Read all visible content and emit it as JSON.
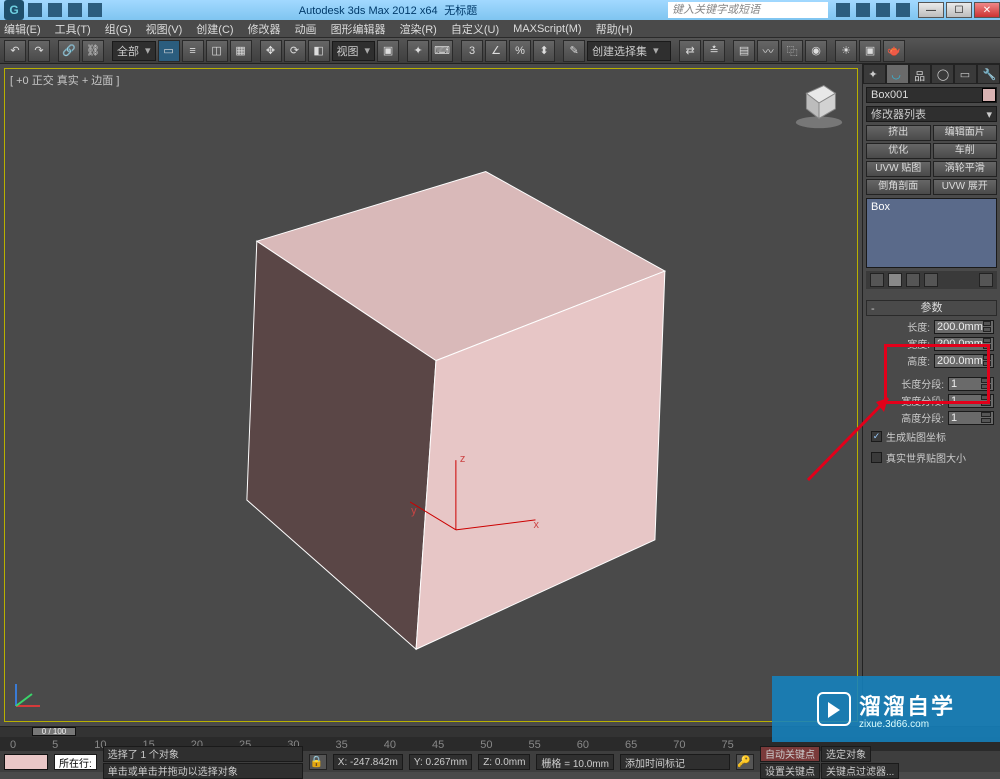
{
  "title": {
    "app": "Autodesk 3ds Max  2012 x64",
    "doc": "无标题",
    "search_placeholder": "键入关键字或短语"
  },
  "menu": [
    "编辑(E)",
    "工具(T)",
    "组(G)",
    "视图(V)",
    "创建(C)",
    "修改器",
    "动画",
    "图形编辑器",
    "渲染(R)",
    "自定义(U)",
    "MAXScript(M)",
    "帮助(H)"
  ],
  "toolbar": {
    "all": "全部",
    "view": "视图",
    "selset": "创建选择集"
  },
  "viewport": {
    "label": "[ +0 正交 真实 + 边面 ]"
  },
  "cmd": {
    "object_name": "Box001",
    "modlist": "修改器列表",
    "buttons": [
      "挤出",
      "编辑面片",
      "优化",
      "车削",
      "UVW 贴图",
      "涡轮平滑",
      "倒角剖面",
      "UVW 展开"
    ],
    "stack_item": "Box",
    "rollout": "参数",
    "params": {
      "length_l": "长度:",
      "length_v": "200.0mm",
      "width_l": "宽度:",
      "width_v": "200.0mm",
      "height_l": "高度:",
      "height_v": "200.0mm",
      "lseg_l": "长度分段:",
      "lseg_v": "1",
      "wseg_l": "宽度分段:",
      "wseg_v": "1",
      "hseg_l": "高度分段:",
      "hseg_v": "1"
    },
    "chk1": "生成贴图坐标",
    "chk2": "真实世界贴图大小"
  },
  "time": {
    "slider": "0 / 100",
    "ticks": [
      "0",
      "5",
      "10",
      "15",
      "20",
      "25",
      "30",
      "35",
      "40",
      "45",
      "50",
      "55",
      "60",
      "65",
      "70",
      "75"
    ]
  },
  "status": {
    "row_label": "所在行:",
    "sel": "选择了 1 个对象",
    "hint": "单击或单击并拖动以选择对象",
    "x": "X: -247.842m",
    "y": "Y: 0.267mm",
    "z": "Z: 0.0mm",
    "grid": "栅格 = 10.0mm",
    "autokey": "自动关键点",
    "selonly": "选定对象",
    "setkey": "设置关键点",
    "keyfilt": "关键点过滤器...",
    "addtime": "添加时间标记"
  },
  "watermark": {
    "big": "溜溜自学",
    "small": "zixue.3d66.com"
  }
}
